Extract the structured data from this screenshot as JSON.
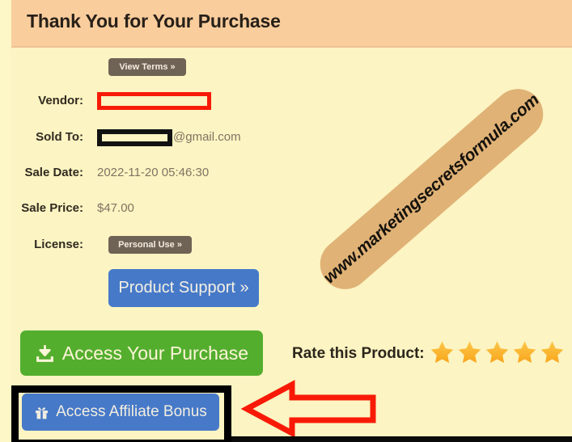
{
  "header": {
    "title": "Thank You for Your Purchase"
  },
  "terms": {
    "view_terms_label": "View Terms »"
  },
  "details": [
    {
      "label": "Vendor:",
      "value": "",
      "redaction": "red"
    },
    {
      "label": "Sold To:",
      "value": "@gmail.com",
      "redaction": "black"
    },
    {
      "label": "Sale Date:",
      "value": "2022-11-20 05:46:30",
      "redaction": "none"
    },
    {
      "label": "Sale Price:",
      "value": "$47.00",
      "redaction": "none"
    },
    {
      "label": "License:",
      "value": "Personal Use »",
      "redaction": "none"
    }
  ],
  "row_labels": {
    "vendor": "Vendor:",
    "sold_to": "Sold To:",
    "sale_date": "Sale Date:",
    "sale_price": "Sale Price:",
    "license": "License:"
  },
  "row_values": {
    "email_suffix": "@gmail.com",
    "sale_date": "2022-11-20 05:46:30",
    "sale_price": "$47.00",
    "license_pill": "Personal Use »"
  },
  "watermark": {
    "text": "www.marketingsecretsformula.com"
  },
  "buttons": {
    "product_support": "Product Support »",
    "access_purchase": "Access Your Purchase",
    "affiliate_bonus": "Access Affiliate Bonus"
  },
  "rating": {
    "label": "Rate this Product:",
    "star_count": 5,
    "stars_filled": 5
  },
  "icons": {
    "download": "download-icon",
    "gift": "gift-icon",
    "star": "star-icon",
    "arrow_left": "arrow-left-icon"
  },
  "colors": {
    "header_bg": "#facd9d",
    "body_bg": "#fcf4c2",
    "pill": "#6f6355",
    "blue": "#4679c8",
    "green": "#54ae2e",
    "star": "#f9a51b",
    "redact_red": "#f81a07",
    "redact_black": "#111111",
    "watermark_bar": "#e0b276",
    "arrow_red": "#f81a07",
    "highlight_border": "#000000"
  }
}
